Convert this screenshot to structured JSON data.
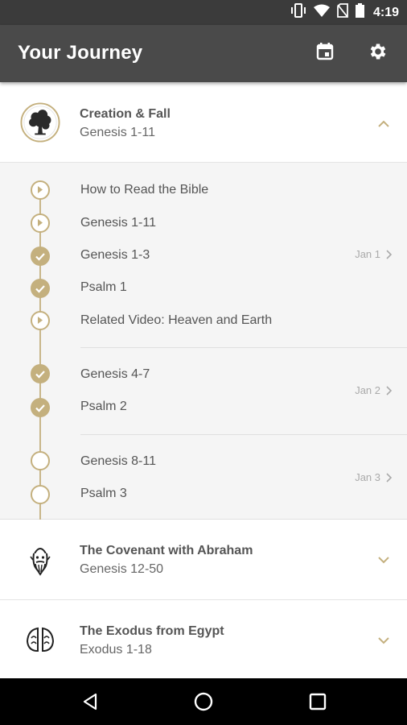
{
  "status_bar": {
    "time": "4:19",
    "icons": [
      "vibrate-icon",
      "wifi-icon",
      "no-sim-icon",
      "battery-icon"
    ]
  },
  "app_bar": {
    "title": "Your Journey",
    "actions": [
      "calendar-icon",
      "settings-gear-icon"
    ]
  },
  "sections": [
    {
      "title": "Creation & Fall",
      "subtitle": "Genesis 1-11",
      "icon": "tree-icon",
      "expanded": true
    },
    {
      "title": "The Covenant with Abraham",
      "subtitle": "Genesis 12-50",
      "icon": "abraham-face-icon",
      "expanded": false
    },
    {
      "title": "The Exodus from Egypt",
      "subtitle": "Exodus 1-18",
      "icon": "parted-sea-icon",
      "expanded": false
    }
  ],
  "readings": {
    "intro": [
      {
        "label": "How to Read the Bible",
        "state": "play"
      },
      {
        "label": "Genesis 1-11",
        "state": "play"
      }
    ],
    "days": [
      {
        "date": "Jan 1",
        "items": [
          {
            "label": "Genesis 1-3",
            "state": "done"
          },
          {
            "label": "Psalm 1",
            "state": "done"
          },
          {
            "label": "Related Video: Heaven and Earth",
            "state": "play"
          }
        ]
      },
      {
        "date": "Jan 2",
        "items": [
          {
            "label": "Genesis 4-7",
            "state": "done"
          },
          {
            "label": "Psalm 2",
            "state": "done"
          }
        ]
      },
      {
        "date": "Jan 3",
        "items": [
          {
            "label": "Genesis 8-11",
            "state": "todo"
          },
          {
            "label": "Psalm 3",
            "state": "todo"
          }
        ]
      }
    ]
  },
  "colors": {
    "accent": "#c4b07e",
    "app_bar": "#4a4a4a",
    "status_bar": "#3b3b3b",
    "expanded_bg": "#f5f5f5"
  },
  "nav_bar": {
    "buttons": [
      "back-icon",
      "home-icon",
      "recents-icon"
    ]
  }
}
